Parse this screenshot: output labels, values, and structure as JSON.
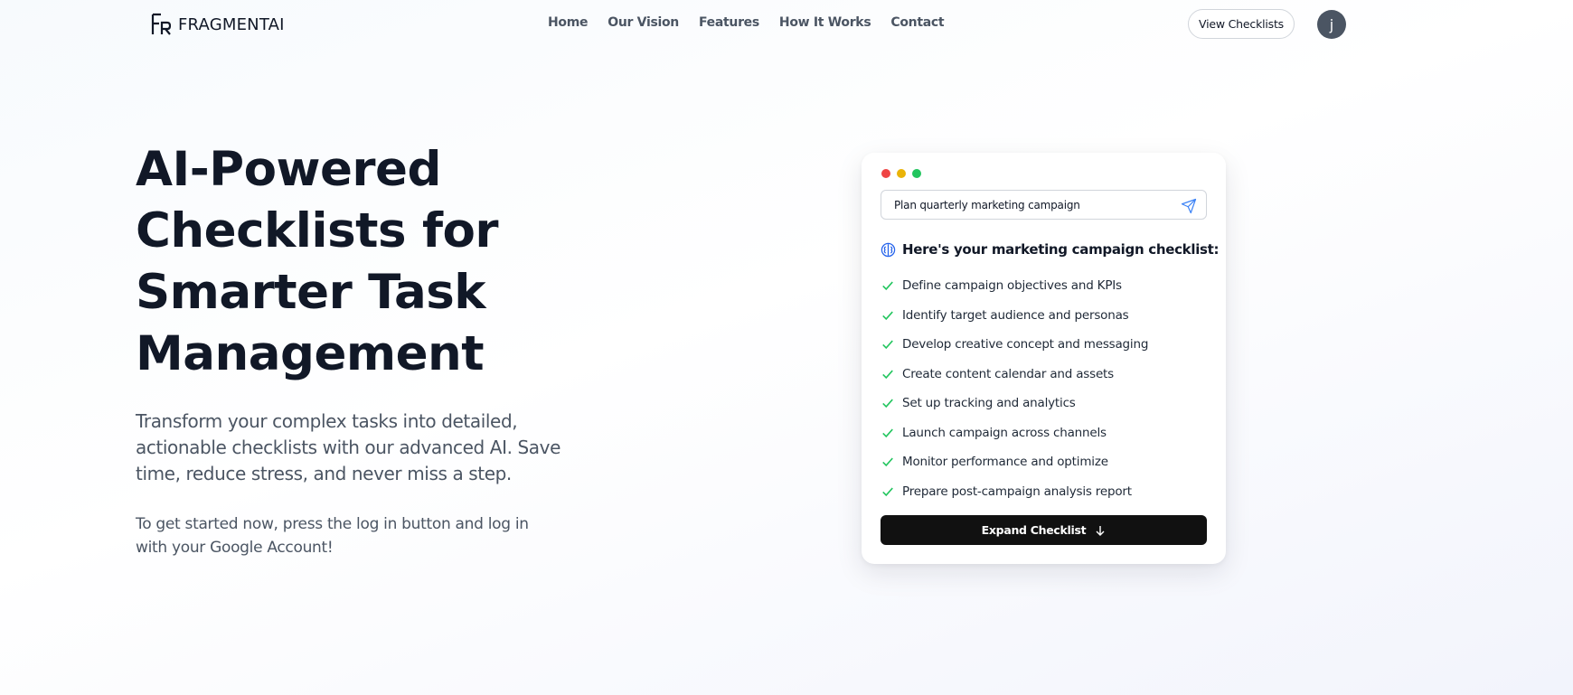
{
  "brand": {
    "name": "FRAGMENTAI"
  },
  "nav": {
    "items": [
      {
        "label": "Home"
      },
      {
        "label": "Our Vision"
      },
      {
        "label": "Features"
      },
      {
        "label": "How It Works"
      },
      {
        "label": "Contact"
      }
    ]
  },
  "header": {
    "view_checklists_label": "View Checklists",
    "avatar_initial": "j"
  },
  "hero": {
    "title": "AI-Powered Checklists for Smarter Task Management",
    "subtitle": "Transform your complex tasks into detailed, actionable checklists with our advanced AI. Save time, reduce stress, and never miss a step.",
    "note": "To get started now, press the log in button and log in with your Google Account!"
  },
  "demo": {
    "window_dots": [
      {
        "color": "#ef4444",
        "icon": "close-dot"
      },
      {
        "color": "#eab308",
        "icon": "minimize-dot"
      },
      {
        "color": "#22c55e",
        "icon": "maximize-dot"
      }
    ],
    "prompt_value": "Plan quarterly marketing campaign",
    "result_title": "Here's your marketing campaign checklist:",
    "checklist": [
      "Define campaign objectives and KPIs",
      "Identify target audience and personas",
      "Develop creative concept and messaging",
      "Create content calendar and assets",
      "Set up tracking and analytics",
      "Launch campaign across channels",
      "Monitor performance and optimize",
      "Prepare post-campaign analysis report"
    ],
    "expand_label": "Expand Checklist"
  },
  "colors": {
    "accent_dark": "#111111",
    "check_green": "#22c55e",
    "icon_blue": "#2563eb"
  }
}
